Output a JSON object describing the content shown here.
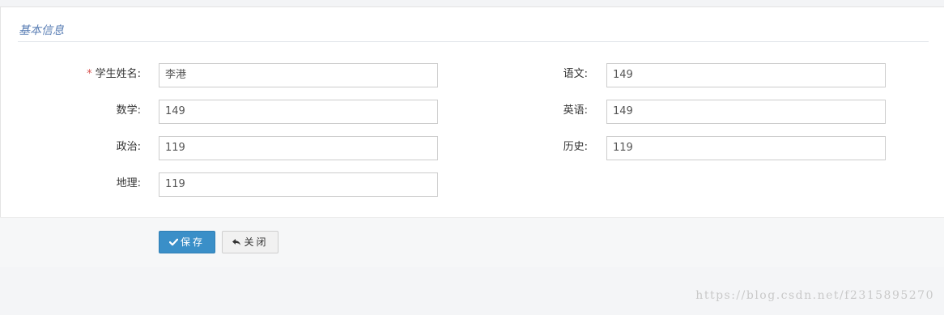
{
  "section": {
    "title": "基本信息"
  },
  "form": {
    "required_mark": "*",
    "student_name": {
      "label": "学生姓名:",
      "value": "李港"
    },
    "chinese": {
      "label": "语文:",
      "value": "149"
    },
    "math": {
      "label": "数学:",
      "value": "149"
    },
    "english": {
      "label": "英语:",
      "value": "149"
    },
    "politics": {
      "label": "政治:",
      "value": "119"
    },
    "history": {
      "label": "历史:",
      "value": "119"
    },
    "geography": {
      "label": "地理:",
      "value": "119"
    }
  },
  "footer": {
    "save_label": "保存",
    "close_label": "关闭"
  },
  "watermark": {
    "text": "https://blog.csdn.net/f2315895270"
  },
  "colors": {
    "accent": "#3a8fc8",
    "section_title": "#5b7fb5",
    "required": "#d9534f"
  },
  "icons": {
    "save": "check-icon",
    "close": "reply-icon"
  }
}
